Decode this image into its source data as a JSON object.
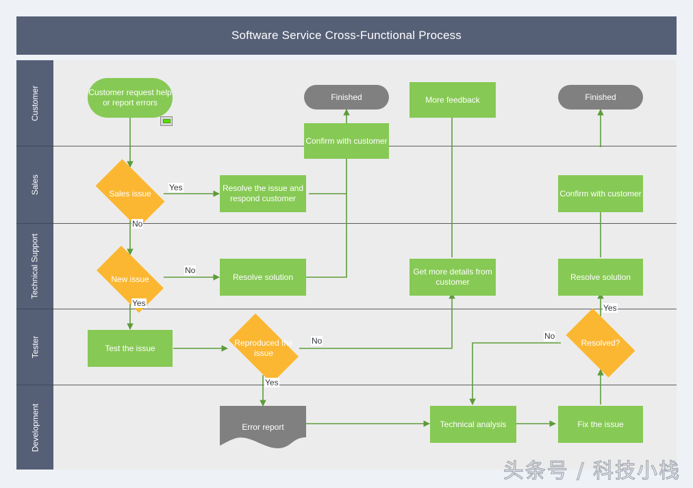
{
  "header": {
    "title": "Software Service Cross-Functional Process"
  },
  "colors": {
    "header_bar": "#555f76",
    "lane_header": "#555f76",
    "lane_body": "#ececec",
    "process_green": "#86c954",
    "decision_orange": "#fbb731",
    "terminator_gray": "#808080",
    "connector_green": "#5d9c3a",
    "page_background": "#eef1f6"
  },
  "lanes": [
    {
      "label": "Customer"
    },
    {
      "label": "Sales"
    },
    {
      "label": "Technical Support"
    },
    {
      "label": "Tester"
    },
    {
      "label": "Development"
    }
  ],
  "nodes": [
    {
      "id": "start",
      "label": "Customer request help or report errors",
      "shape": "terminator",
      "lane": "Customer"
    },
    {
      "id": "finished_left",
      "label": "Finished",
      "shape": "end",
      "lane": "Customer"
    },
    {
      "id": "more_feedback",
      "label": "More feedback",
      "shape": "process",
      "lane": "Customer"
    },
    {
      "id": "finished_right",
      "label": "Finished",
      "shape": "end",
      "lane": "Customer"
    },
    {
      "id": "confirm_left",
      "label": "Confirm with customer",
      "shape": "process",
      "lane": "Customer/Sales"
    },
    {
      "id": "sales_issue",
      "label": "Sales issue",
      "shape": "decision",
      "lane": "Sales"
    },
    {
      "id": "resolve_respond",
      "label": "Resolve the issue and respond customer",
      "shape": "process",
      "lane": "Sales"
    },
    {
      "id": "confirm_right",
      "label": "Confirm with customer",
      "shape": "process",
      "lane": "Sales"
    },
    {
      "id": "new_issue",
      "label": "New issue",
      "shape": "decision",
      "lane": "Technical Support"
    },
    {
      "id": "resolve_solution_1",
      "label": "Resolve solution",
      "shape": "process",
      "lane": "Technical Support"
    },
    {
      "id": "get_more_details",
      "label": "Get more details from customer",
      "shape": "process",
      "lane": "Technical Support"
    },
    {
      "id": "resolve_solution_2",
      "label": "Resolve solution",
      "shape": "process",
      "lane": "Technical Support"
    },
    {
      "id": "test_issue",
      "label": "Test the issue",
      "shape": "process",
      "lane": "Tester"
    },
    {
      "id": "reproduced",
      "label": "Reproduced the issue",
      "shape": "decision",
      "lane": "Tester"
    },
    {
      "id": "resolved",
      "label": "Resolved?",
      "shape": "decision",
      "lane": "Tester"
    },
    {
      "id": "error_report",
      "label": "Error report",
      "shape": "document",
      "lane": "Development"
    },
    {
      "id": "technical_analysis",
      "label": "Technical analysis",
      "shape": "process",
      "lane": "Development"
    },
    {
      "id": "fix_issue",
      "label": "Fix the issue",
      "shape": "process",
      "lane": "Development"
    }
  ],
  "edge_labels": {
    "sales_yes": "Yes",
    "sales_no": "No",
    "new_issue_no": "No",
    "new_issue_yes": "Yes",
    "reproduced_no": "No",
    "reproduced_yes": "Yes",
    "resolved_yes": "Yes",
    "resolved_no": "No"
  },
  "badge": {
    "name": "note-indicator"
  },
  "watermark": {
    "text": "头条号 / 科技小栈"
  }
}
